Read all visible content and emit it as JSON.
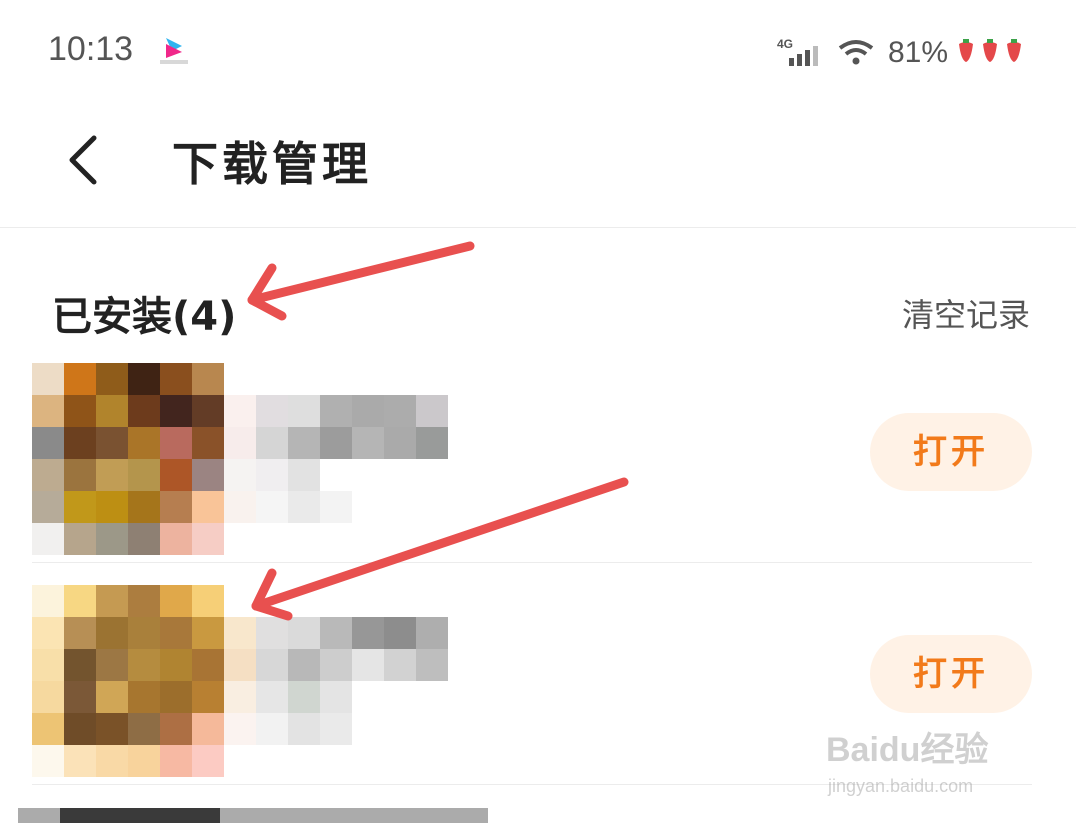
{
  "status_bar": {
    "time": "10:13",
    "app_logo_icon": "youku-logo",
    "network": "4G",
    "battery": "81%",
    "icons": [
      "signal-icon",
      "wifi-icon",
      "strawberry-icon"
    ]
  },
  "header": {
    "back_icon": "chevron-left-icon",
    "title": "下载管理"
  },
  "section": {
    "title": "已安装(4)",
    "clear_label": "清空记录"
  },
  "apps": [
    {
      "open_label": "打开",
      "mosaic_colors": [
        [
          "#eddcc6",
          "#cf7619",
          "#8f5c1a",
          "#3f2314",
          "#8a4f1e",
          "#b8874f",
          "#ffffff",
          "#ffffff",
          "#ffffff",
          "#ffffff",
          "#ffffff",
          "#ffffff",
          "#ffffff"
        ],
        [
          "#dcb480",
          "#8f5418",
          "#b1842c",
          "#6d3b1c",
          "#42251e",
          "#633c26",
          "#faf0ee",
          "#e1dde0",
          "#dedede",
          "#b0b0b0",
          "#aaaaaa",
          "#acacac",
          "#cbc8cb"
        ],
        [
          "#8a8a8a",
          "#6c401f",
          "#7a5231",
          "#aa7528",
          "#b96a5e",
          "#8a5229",
          "#f7eceb",
          "#d5d5d5",
          "#b5b5b5",
          "#9c9c9c",
          "#b5b5b5",
          "#aaaaaa",
          "#999b9a"
        ],
        [
          "#bdab90",
          "#9b743e",
          "#c19d55",
          "#b4954c",
          "#ad5627",
          "#9b8482",
          "#f5f3f2",
          "#f0eef0",
          "#e2e2e2",
          "#ffffff",
          "#ffffff",
          "#ffffff",
          "#ffffff"
        ],
        [
          "#b6ab99",
          "#c1981a",
          "#bd8f13",
          "#a5751b",
          "#b67e50",
          "#f9c498",
          "#f9f2ee",
          "#f5f5f5",
          "#eaeaea",
          "#f3f3f3",
          "#ffffff",
          "#ffffff",
          "#ffffff"
        ],
        [
          "#f1f0ef",
          "#b6a58c",
          "#9c9888",
          "#8e8073",
          "#edb39f",
          "#f6cdc5",
          "#ffffff",
          "#ffffff",
          "#ffffff",
          "#ffffff",
          "#ffffff",
          "#ffffff",
          "#ffffff"
        ]
      ]
    },
    {
      "open_label": "打开",
      "mosaic_colors": [
        [
          "#fcf3dc",
          "#f7d783",
          "#c59a52",
          "#ac7d3f",
          "#e0a84a",
          "#f6cf77",
          "#ffffff",
          "#ffffff",
          "#ffffff",
          "#ffffff",
          "#ffffff",
          "#ffffff",
          "#ffffff"
        ],
        [
          "#fbe4b3",
          "#b78f55",
          "#9b7332",
          "#a9803b",
          "#a8783a",
          "#c99940",
          "#f8e7cc",
          "#e0dfdf",
          "#dadada",
          "#b9b9b9",
          "#979797",
          "#8d8d8d",
          "#aeaeae"
        ],
        [
          "#f8dfa9",
          "#73542e",
          "#9c7744",
          "#b58c3f",
          "#b08431",
          "#a87434",
          "#f5dfc3",
          "#d7d7d7",
          "#b8b8b8",
          "#cdcdcd",
          "#e5e5e5",
          "#d2d2d2",
          "#bebebe"
        ],
        [
          "#f6d99f",
          "#7b5837",
          "#d0a656",
          "#a7762f",
          "#9c6e2c",
          "#b88032",
          "#f9eee1",
          "#e6e6e6",
          "#d0d6d0",
          "#e4e4e4",
          "#ffffff",
          "#ffffff",
          "#ffffff"
        ],
        [
          "#edc474",
          "#6f4c28",
          "#7a5228",
          "#8e6d45",
          "#ad6f44",
          "#f5b99a",
          "#fbf3f0",
          "#f2f2f2",
          "#e3e3e3",
          "#eaeaea",
          "#ffffff",
          "#ffffff",
          "#ffffff"
        ],
        [
          "#fdf8ed",
          "#fbe2b8",
          "#f9d9a6",
          "#f8d39c",
          "#f7b9a3",
          "#fccbc3",
          "#ffffff",
          "#ffffff",
          "#ffffff",
          "#ffffff",
          "#ffffff",
          "#ffffff",
          "#ffffff"
        ]
      ]
    }
  ],
  "annotation_color": "#e8504f",
  "accent_color": "#f27a1a",
  "watermark": {
    "main": "Baidu经验",
    "sub": "jingyan.baidu.com"
  }
}
